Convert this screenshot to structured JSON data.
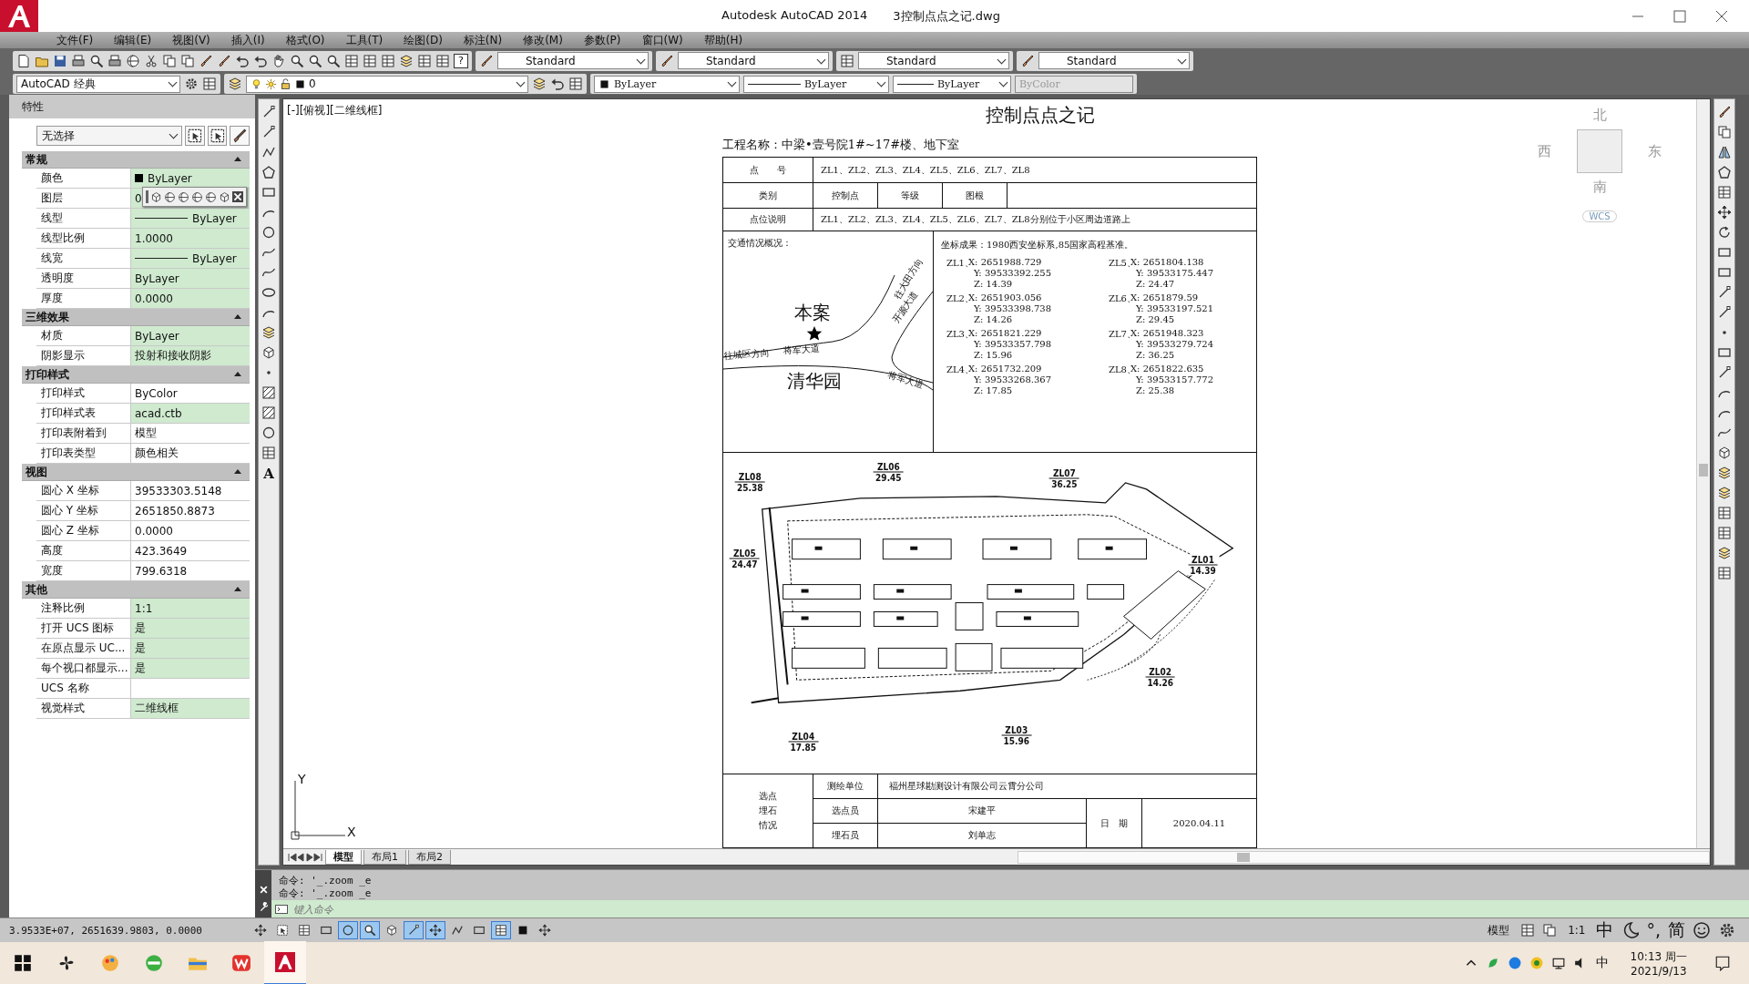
{
  "window": {
    "app": "Autodesk AutoCAD 2014",
    "file": "3控制点点之记.dwg"
  },
  "menu": [
    "文件(F)",
    "编辑(E)",
    "视图(V)",
    "插入(I)",
    "格式(O)",
    "工具(T)",
    "绘图(D)",
    "标注(N)",
    "修改(M)",
    "参数(P)",
    "窗口(W)",
    "帮助(H)"
  ],
  "toolbar": {
    "help": "?",
    "styles": [
      "Standard",
      "Standard",
      "Standard",
      "Standard"
    ]
  },
  "layers_bar": {
    "workspace": "AutoCAD 经典",
    "layer": "0",
    "color_setting": "ByLayer",
    "linetype": "ByLayer",
    "lineweight": "ByLayer",
    "plot_style": "ByColor",
    "plot_style_disabled": true
  },
  "properties": {
    "title": "特性",
    "selection": "无选择",
    "sections": [
      {
        "title": "常规",
        "expanded": true,
        "rows": [
          {
            "label": "颜色",
            "value": "ByLayer",
            "kind": "swatch",
            "editable": true
          },
          {
            "label": "图层",
            "value": "0",
            "kind": "text",
            "editable": true
          },
          {
            "label": "线型",
            "value": "ByLayer",
            "kind": "line",
            "editable": true
          },
          {
            "label": "线型比例",
            "value": "1.0000",
            "kind": "text",
            "editable": true
          },
          {
            "label": "线宽",
            "value": "ByLayer",
            "kind": "line",
            "editable": true
          },
          {
            "label": "透明度",
            "value": "ByLayer",
            "kind": "text",
            "editable": true
          },
          {
            "label": "厚度",
            "value": "0.0000",
            "kind": "text",
            "editable": true
          }
        ]
      },
      {
        "title": "三维效果",
        "expanded": true,
        "rows": [
          {
            "label": "材质",
            "value": "ByLayer",
            "kind": "text",
            "editable": true
          },
          {
            "label": "阴影显示",
            "value": "投射和接收阴影",
            "kind": "text",
            "editable": true
          }
        ]
      },
      {
        "title": "打印样式",
        "expanded": true,
        "rows": [
          {
            "label": "打印样式",
            "value": "ByColor",
            "kind": "text",
            "editable": false
          },
          {
            "label": "打印样式表",
            "value": "acad.ctb",
            "kind": "text",
            "editable": true
          },
          {
            "label": "打印表附着到",
            "value": "模型",
            "kind": "text",
            "editable": false
          },
          {
            "label": "打印表类型",
            "value": "颜色相关",
            "kind": "text",
            "editable": false
          }
        ]
      },
      {
        "title": "视图",
        "expanded": true,
        "rows": [
          {
            "label": "圆心 X 坐标",
            "value": "39533303.5148",
            "kind": "text",
            "editable": false
          },
          {
            "label": "圆心 Y 坐标",
            "value": "2651850.8873",
            "kind": "text",
            "editable": false
          },
          {
            "label": "圆心 Z 坐标",
            "value": "0.0000",
            "kind": "text",
            "editable": false
          },
          {
            "label": "高度",
            "value": "423.3649",
            "kind": "text",
            "editable": false
          },
          {
            "label": "宽度",
            "value": "799.6318",
            "kind": "text",
            "editable": false
          }
        ]
      },
      {
        "title": "其他",
        "expanded": true,
        "rows": [
          {
            "label": "注释比例",
            "value": "1:1",
            "kind": "text",
            "editable": true
          },
          {
            "label": "打开 UCS 图标",
            "value": "是",
            "kind": "text",
            "editable": true
          },
          {
            "label": "在原点显示 UC...",
            "value": "是",
            "kind": "text",
            "editable": true
          },
          {
            "label": "每个视口都显示...",
            "value": "是",
            "kind": "text",
            "editable": true
          },
          {
            "label": "UCS 名称",
            "value": "",
            "kind": "text",
            "editable": false
          },
          {
            "label": "视觉样式",
            "value": "二维线框",
            "kind": "text",
            "editable": true
          }
        ]
      }
    ]
  },
  "draw_toolbar": {
    "text_tool": "A"
  },
  "drawing": {
    "viewport_label": "[-][俯视][二维线框]",
    "sheet": {
      "title": "控制点点之记",
      "project": "工程名称：中梁•壹号院1#~17#楼、地下室",
      "point_no": {
        "label": "点　　号",
        "value": "ZL1、ZL2、ZL3、ZL4、ZL5、ZL6、ZL7、ZL8"
      },
      "category": {
        "label": "类别",
        "cells": [
          "控制点",
          "等级",
          "图根"
        ]
      },
      "location": {
        "label": "点位说明",
        "value": "ZL1、ZL2、ZL3、ZL4、ZL5、ZL6、ZL7、ZL8分别位于小区周边道路上"
      },
      "traffic": {
        "title": "交通情况概况：",
        "site": "本案",
        "neighborhood": "清华园",
        "roads": [
          "往城区方向",
          "将军大道",
          "开源大道",
          "往大田方向",
          "将军大道"
        ]
      },
      "coordinates": {
        "title": "坐标成果：1980西安坐标系,85国家高程基准。",
        "points": [
          {
            "name": "ZL1、",
            "x": "X: 2651988.729",
            "y": "Y: 39533392.255",
            "z": "Z: 14.39"
          },
          {
            "name": "ZL2、",
            "x": "X: 2651903.056",
            "y": "Y: 39533398.738",
            "z": "Z: 14.26"
          },
          {
            "name": "ZL3、",
            "x": "X: 2651821.229",
            "y": "Y: 39533357.798",
            "z": "Z: 15.96"
          },
          {
            "name": "ZL4、",
            "x": "X: 2651732.209",
            "y": "Y: 39533268.367",
            "z": "Z: 17.85"
          },
          {
            "name": "ZL5、",
            "x": "X: 2651804.138",
            "y": "Y: 39533175.447",
            "z": "Z: 24.47"
          },
          {
            "name": "ZL6、",
            "x": "X: 2651879.59",
            "y": "Y: 39533197.521",
            "z": "Z: 29.45"
          },
          {
            "name": "ZL7、",
            "x": "X: 2651948.323",
            "y": "Y: 39533279.724",
            "z": "Z: 36.25"
          },
          {
            "name": "ZL8、",
            "x": "X: 2651822.635",
            "y": "Y: 39533157.772",
            "z": "Z: 25.38"
          }
        ]
      },
      "plan_points": [
        {
          "name": "ZL08",
          "elevation": "25.38"
        },
        {
          "name": "ZL06",
          "elevation": "29.45"
        },
        {
          "name": "ZL07",
          "elevation": "36.25"
        },
        {
          "name": "ZL05",
          "elevation": "24.47"
        },
        {
          "name": "ZL01",
          "elevation": "14.39"
        },
        {
          "name": "ZL02",
          "elevation": "14.26"
        },
        {
          "name": "ZL04",
          "elevation": "17.85"
        },
        {
          "name": "ZL03",
          "elevation": "15.96"
        }
      ],
      "footer": {
        "section": [
          "选点",
          "埋石",
          "情况"
        ],
        "unit": {
          "label": "测绘单位",
          "value": "福州星球勘测设计有限公司云霄分公司"
        },
        "selector": {
          "label": "选点员",
          "value": "宋建平"
        },
        "burier": {
          "label": "埋石员",
          "value": "刘单志"
        },
        "date": {
          "label": "日　期",
          "value": "2020.04.11"
        }
      }
    },
    "viewcube": {
      "north": "北",
      "south": "南",
      "east": "东",
      "west": "西",
      "wcs": "WCS"
    },
    "ucs": {
      "x": "X",
      "y": "Y"
    }
  },
  "layout_tabs": [
    {
      "label": "模型",
      "selected": true
    },
    {
      "label": "布局1",
      "selected": false
    },
    {
      "label": "布局2",
      "selected": false
    }
  ],
  "command": {
    "history": [
      "命令: '_.zoom _e",
      "命令: '_.zoom _e"
    ],
    "placeholder": "键入命令"
  },
  "status_bar": {
    "coordinates": "3.9533E+07, 2651639.9803, 0.0000",
    "toggles": [
      {
        "on": false
      },
      {
        "on": false
      },
      {
        "on": false
      },
      {
        "on": false
      },
      {
        "on": true
      },
      {
        "on": true
      },
      {
        "on": false
      },
      {
        "on": true
      },
      {
        "on": true
      },
      {
        "on": false
      },
      {
        "on": false
      },
      {
        "on": true
      },
      {
        "on": false
      },
      {
        "on": false
      }
    ],
    "space": "模型",
    "scale": "1:1"
  },
  "ime": {
    "mode": "中",
    "punct": "°,",
    "script": "简"
  },
  "taskbar": {
    "tray_lang": "中",
    "time": "10:13 周一",
    "date": "2021/9/13"
  }
}
